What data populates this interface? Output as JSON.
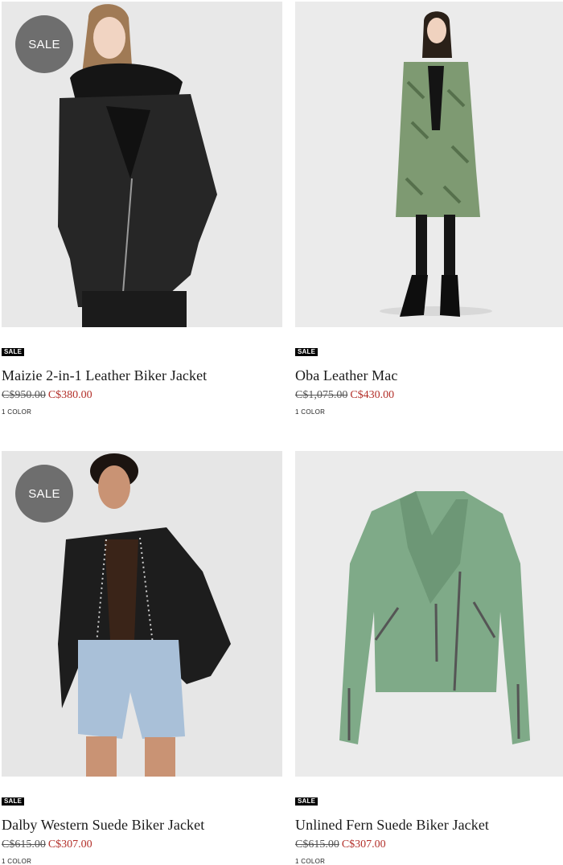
{
  "products": [
    {
      "name": "Maizie 2-in-1 Leather Biker Jacket",
      "badge": "SALE",
      "overlay_badge": "SALE",
      "price_original": "C$950.00",
      "price_sale": "C$380.00",
      "colors": "1 COLOR"
    },
    {
      "name": "Oba Leather Mac",
      "badge": "SALE",
      "price_original": "C$1,075.00",
      "price_sale": "C$430.00",
      "colors": "1 COLOR"
    },
    {
      "name": "Dalby Western Suede Biker Jacket",
      "badge": "SALE",
      "overlay_badge": "SALE",
      "price_original": "C$615.00",
      "price_sale": "C$307.00",
      "colors": "1 COLOR"
    },
    {
      "name": "Unlined Fern Suede Biker Jacket",
      "badge": "SALE",
      "price_original": "C$615.00",
      "price_sale": "C$307.00",
      "colors": "1 COLOR"
    }
  ],
  "colors": {
    "sale_price": "#b3302a",
    "sale_circle": "#6e6e6e",
    "sale_tag": "#000000"
  }
}
